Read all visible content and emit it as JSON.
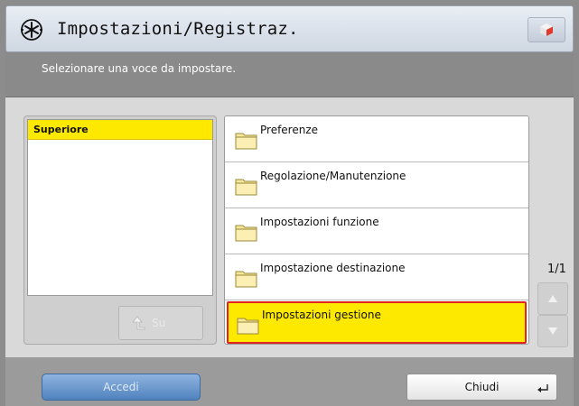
{
  "header": {
    "title": "Impostazioni/Registraz.",
    "icon": "settings-star-icon",
    "right_button_icon": "cube-icon"
  },
  "instruction": "Selezionare una voce da impostare.",
  "tree": {
    "selected_label": "Superiore",
    "up_button_label": "Su",
    "up_button_icon": "up-return-arrow-icon"
  },
  "list": {
    "items": [
      {
        "label": "Preferenze",
        "icon": "folder-icon",
        "selected": false
      },
      {
        "label": "Regolazione/Manutenzione",
        "icon": "folder-icon",
        "selected": false
      },
      {
        "label": "Impostazioni funzione",
        "icon": "folder-icon",
        "selected": false
      },
      {
        "label": "Impostazione destinazione",
        "icon": "folder-icon",
        "selected": false
      },
      {
        "label": "Impostazioni gestione",
        "icon": "folder-icon",
        "selected": true
      }
    ],
    "page_indicator": "1/1"
  },
  "footer": {
    "login_label": "Accedi",
    "close_label": "Chiudi",
    "close_icon": "return-icon"
  },
  "colors": {
    "selection": "#fde800",
    "selection_border": "#e0231d",
    "login_button": "#4f82be"
  }
}
